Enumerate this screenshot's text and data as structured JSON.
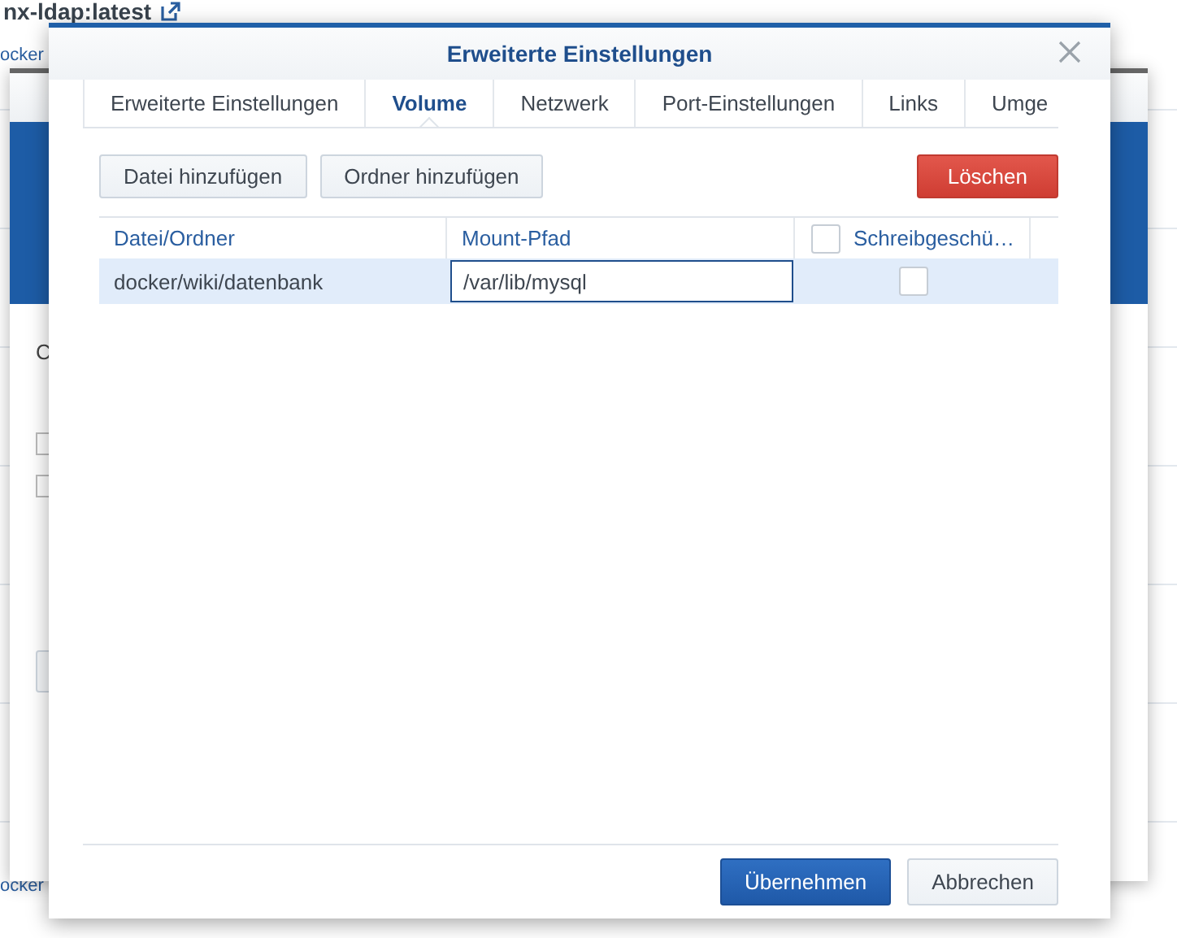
{
  "background": {
    "title": "nx-ldap:latest",
    "subtitle": "ocker",
    "last_subtitle": "ocker"
  },
  "middle_window": {
    "body_text": "C",
    "checkboxes": [
      {
        "checked": false
      },
      {
        "checked": false
      }
    ]
  },
  "dialog": {
    "title": "Erweiterte Einstellungen",
    "tabs": [
      {
        "label": "Erweiterte Einstellungen",
        "selected": false
      },
      {
        "label": "Volume",
        "selected": true
      },
      {
        "label": "Netzwerk",
        "selected": false
      },
      {
        "label": "Port-Einstellungen",
        "selected": false
      },
      {
        "label": "Links",
        "selected": false
      },
      {
        "label": "Umge",
        "selected": false
      }
    ],
    "toolbar": [
      {
        "label": "Datei hinzufügen",
        "kind": "default"
      },
      {
        "label": "Ordner hinzufügen",
        "kind": "default"
      },
      {
        "label": "Löschen",
        "kind": "danger"
      }
    ],
    "table": {
      "columns": [
        {
          "label": "Datei/Ordner"
        },
        {
          "label": "Mount-Pfad"
        },
        {
          "label": "Schreibgeschü…"
        }
      ],
      "header_checkbox": {
        "checked": false
      },
      "rows": [
        {
          "path": "docker/wiki/datenbank",
          "mount_path": "/var/lib/mysql",
          "read_only": false,
          "selected": true
        }
      ]
    },
    "footer": [
      {
        "label": "Übernehmen",
        "kind": "primary"
      },
      {
        "label": "Abbrechen",
        "kind": "default"
      }
    ]
  }
}
